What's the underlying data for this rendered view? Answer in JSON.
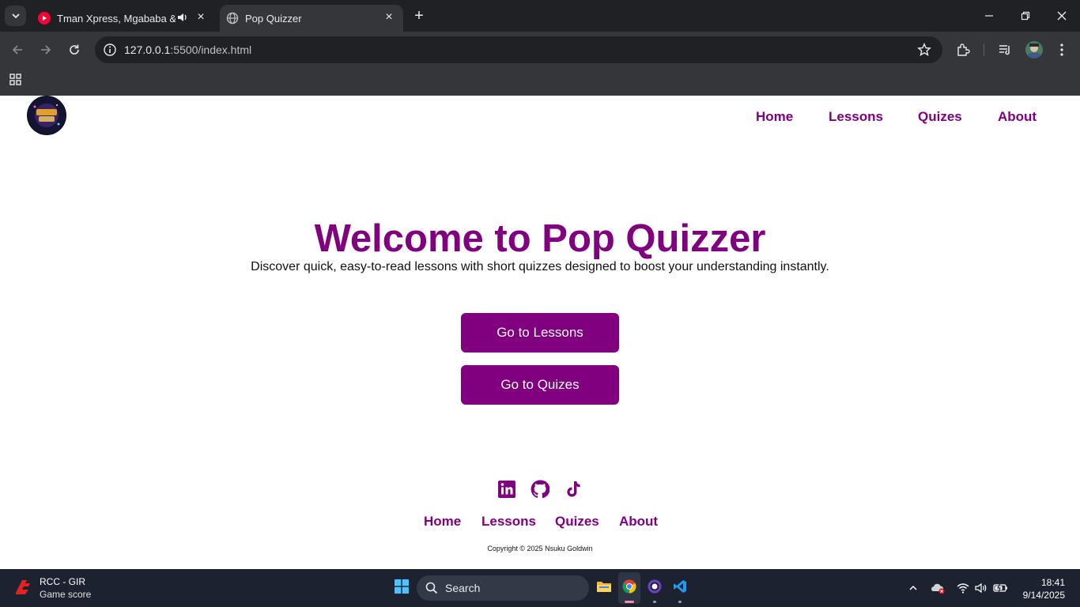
{
  "browser": {
    "tabs": [
      {
        "title": "Tman Xpress, Mgababa & L",
        "active": false,
        "audio": true
      },
      {
        "title": "Pop Quizzer",
        "active": true,
        "audio": false
      }
    ],
    "url_host": "127.0.0.1",
    "url_rest": ":5500/index.html"
  },
  "site": {
    "nav": {
      "home": "Home",
      "lessons": "Lessons",
      "quizes": "Quizes",
      "about": "About"
    },
    "hero": {
      "title": "Welcome to Pop Quizzer",
      "subtitle": "Discover quick, easy-to-read lessons with short quizzes designed to boost your understanding instantly."
    },
    "buttons": {
      "lessons": "Go to Lessons",
      "quizes": "Go to Quizes"
    },
    "footer": {
      "social_icons": [
        "linkedin-icon",
        "github-icon",
        "tiktok-icon"
      ],
      "nav": {
        "home": "Home",
        "lessons": "Lessons",
        "quizes": "Quizes",
        "about": "About"
      },
      "copyright": "Copyright © 2025 Nsuku Goldwin"
    },
    "accent_color": "#800080"
  },
  "taskbar": {
    "widget": {
      "title": "RCC - GIR",
      "subtitle": "Game score"
    },
    "search_placeholder": "Search",
    "time": "18:41",
    "date": "9/14/2025"
  }
}
